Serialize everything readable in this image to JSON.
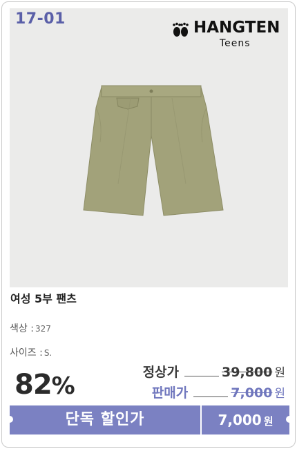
{
  "product": {
    "code": "17-01",
    "brand_name": "HANGTEN",
    "brand_sub": "Teens",
    "title": "여성 5부 팬츠",
    "color_label": "색상 :",
    "color_value": "327",
    "size_label": "사이즈 :",
    "size_value": "S."
  },
  "pricing": {
    "discount": "82",
    "percent_symbol": "%",
    "regular_label": "정상가",
    "regular_price": "39,800",
    "sale_label": "판매가",
    "sale_price": "7,000",
    "currency": "원"
  },
  "banner": {
    "label": "단독 할인가",
    "price": "7,000",
    "currency": "원"
  },
  "colors": {
    "accent": "#7b81c2",
    "sale_text": "#6f76bd",
    "code_text": "#5a5fa8",
    "shorts": "#a2a27a"
  },
  "icons": [
    "footprint-logo-icon"
  ]
}
